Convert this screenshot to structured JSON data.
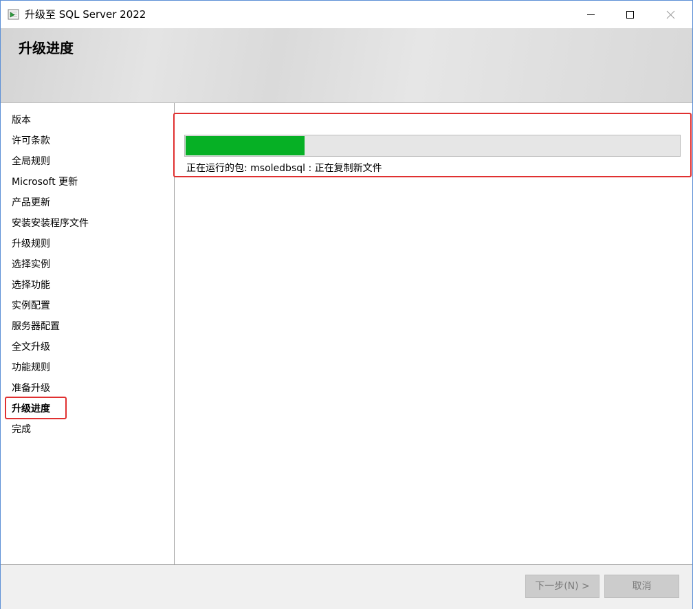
{
  "window": {
    "title": "升级至 SQL Server 2022",
    "icon": "setup-icon",
    "controls": {
      "minimize": "minimize-icon",
      "maximize": "maximize-icon",
      "close": "close-icon"
    }
  },
  "header": {
    "title": "升级进度"
  },
  "nav": {
    "items": [
      {
        "label": "版本",
        "active": false
      },
      {
        "label": "许可条款",
        "active": false
      },
      {
        "label": "全局规则",
        "active": false
      },
      {
        "label": "Microsoft 更新",
        "active": false
      },
      {
        "label": "产品更新",
        "active": false
      },
      {
        "label": "安装安装程序文件",
        "active": false
      },
      {
        "label": "升级规则",
        "active": false
      },
      {
        "label": "选择实例",
        "active": false
      },
      {
        "label": "选择功能",
        "active": false
      },
      {
        "label": "实例配置",
        "active": false
      },
      {
        "label": "服务器配置",
        "active": false
      },
      {
        "label": "全文升级",
        "active": false
      },
      {
        "label": "功能规则",
        "active": false
      },
      {
        "label": "准备升级",
        "active": false
      },
      {
        "label": "升级进度",
        "active": true
      },
      {
        "label": "完成",
        "active": false
      }
    ]
  },
  "content": {
    "progress_fraction": 0.24,
    "status": "正在运行的包: msoledbsql : 正在复制新文件"
  },
  "footer": {
    "next_label": "下一步(N) >",
    "cancel_label": "取消"
  },
  "colors": {
    "progress_fill": "#06b025",
    "highlight": "#e03030",
    "disabled_text": "#7a7a7a"
  }
}
